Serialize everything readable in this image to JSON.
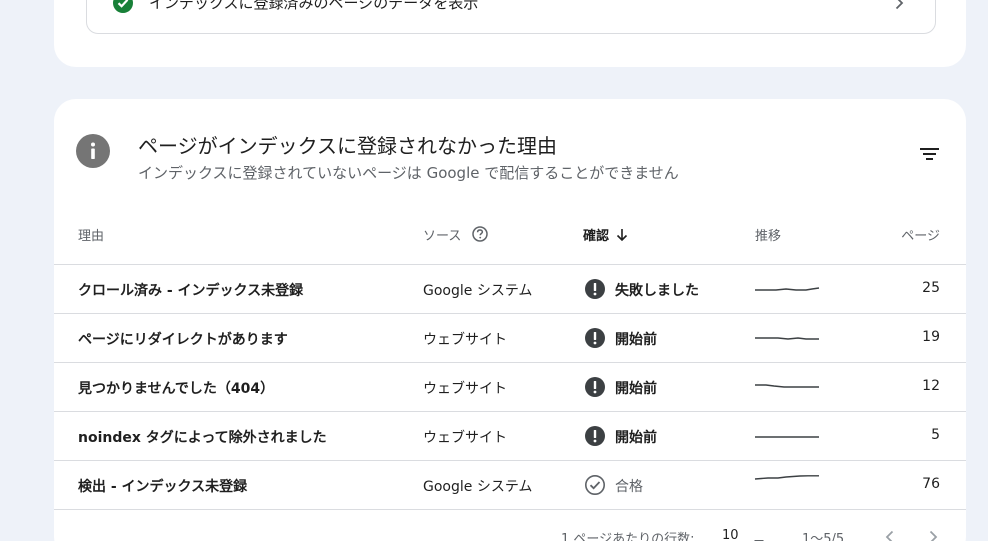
{
  "top_card": {
    "link_text": "インデックスに登録済みのページのデータを表示"
  },
  "card": {
    "title": "ページがインデックスに登録されなかった理由",
    "subtitle": "インデックスに登録されていないページは Google で配信することができません"
  },
  "table": {
    "headers": {
      "reason": "理由",
      "source": "ソース",
      "status": "確認",
      "trend": "推移",
      "pages": "ページ"
    },
    "rows": [
      {
        "reason": "クロール済み - インデックス未登録",
        "source": "Google システム",
        "status": "失敗しました",
        "status_kind": "error",
        "pages": "25"
      },
      {
        "reason": "ページにリダイレクトがあります",
        "source": "ウェブサイト",
        "status": "開始前",
        "status_kind": "error",
        "pages": "19"
      },
      {
        "reason": "見つかりませんでした（404）",
        "source": "ウェブサイト",
        "status": "開始前",
        "status_kind": "error",
        "pages": "12"
      },
      {
        "reason": "noindex タグによって除外されました",
        "source": "ウェブサイト",
        "status": "開始前",
        "status_kind": "error",
        "pages": "5"
      },
      {
        "reason": "検出 - インデックス未登録",
        "source": "Google システム",
        "status": "合格",
        "status_kind": "pass",
        "pages": "76"
      }
    ]
  },
  "pagination": {
    "rows_per_page_label": "1 ページあたりの行数:",
    "rows_per_page_value": "10",
    "range": "1〜5/5"
  },
  "colors": {
    "background": "#eef2f9",
    "pass_green": "#188038",
    "status_icon_dark": "#3c4043",
    "muted_text": "#5f6368"
  }
}
